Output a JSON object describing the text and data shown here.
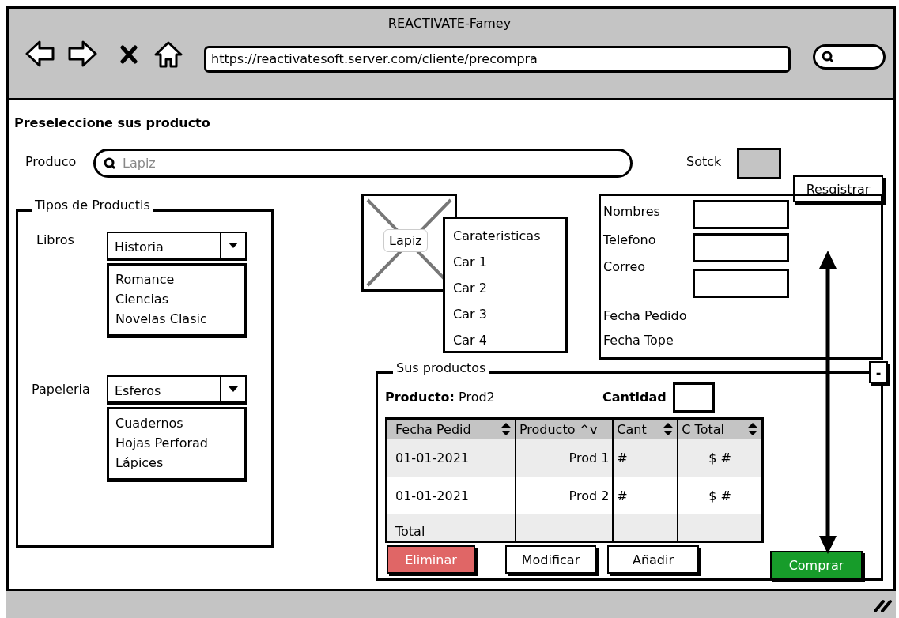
{
  "window": {
    "title": "REACTIVATE-Famey",
    "url": "https://reactivatesoft.server.com/cliente/precompra"
  },
  "heading": "Preseleccione sus producto",
  "product_search": {
    "label": "Produco",
    "placeholder": "Lapiz"
  },
  "stock": {
    "label": "Sotck"
  },
  "register_button": "Resgistrar",
  "types_group": {
    "title": "Tipos de Productis",
    "categories": [
      {
        "label": "Libros",
        "value": "Historia",
        "options": [
          "Romance",
          "Ciencias",
          "Novelas Clasic"
        ]
      },
      {
        "label": "Papeleria",
        "value": "Esferos",
        "options": [
          "Cuadernos",
          "Hojas Perforad",
          "Lápices"
        ]
      }
    ]
  },
  "image": {
    "label": "Lapiz"
  },
  "features": [
    "Carateristicas",
    "Car 1",
    "Car 2",
    "Car 3",
    "Car 4"
  ],
  "customer_form": {
    "fields": [
      {
        "label": "Nombres",
        "kind": "input"
      },
      {
        "label": "Telefono",
        "kind": "input"
      },
      {
        "label": "Correo",
        "kind": "input"
      },
      {
        "label": "Fecha Pedido",
        "kind": "text"
      },
      {
        "label": "Fecha Tope",
        "kind": "text"
      }
    ]
  },
  "products_group": {
    "title": "Sus productos",
    "collapse_button": "-",
    "product_label": "Producto:",
    "product_value": "Prod2",
    "quantity_label": "Cantidad",
    "table": {
      "columns": [
        {
          "label": "Fecha Pedid",
          "sortable": true
        },
        {
          "label": "Producto ^v",
          "sortable": false
        },
        {
          "label": "Cant",
          "sortable": true
        },
        {
          "label": "C Total",
          "sortable": true
        }
      ],
      "rows": [
        [
          "01-01-2021",
          "Prod 1",
          "#",
          "$ #"
        ],
        [
          "01-01-2021",
          "Prod 2",
          "#",
          "$ #"
        ],
        [
          "Total",
          "",
          "",
          ""
        ]
      ]
    },
    "buttons": [
      {
        "label": "Eliminar",
        "kind": "danger"
      },
      {
        "label": "Modificar",
        "kind": "default"
      },
      {
        "label": "Añadir",
        "kind": "default"
      }
    ]
  },
  "buy_button": {
    "label": "Comprar",
    "kind": "primary"
  }
}
